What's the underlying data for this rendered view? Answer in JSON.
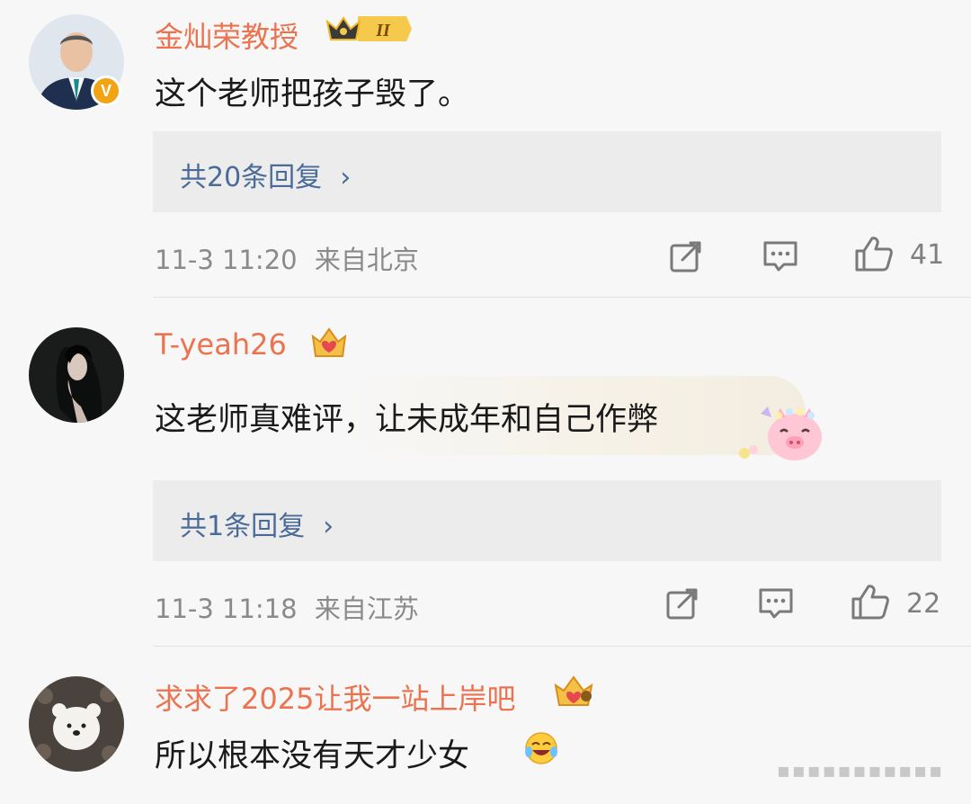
{
  "comments": [
    {
      "username": "金灿荣教授",
      "badge_level": "II",
      "verified_mark": "V",
      "text": "这个老师把孩子毁了。",
      "replies_label": "共20条回复",
      "time": "11-3 11:20",
      "location": "来自北京",
      "likes": "41"
    },
    {
      "username": "T-yeah26",
      "text": "这老师真难评，让未成年和自己作弊",
      "replies_label": "共1条回复",
      "time": "11-3 11:18",
      "location": "来自江苏",
      "likes": "22"
    },
    {
      "username": "求求了2025让我一站上岸吧",
      "text": "所以根本没有天才少女"
    }
  ],
  "icons": {
    "share": "share-icon",
    "comment": "comment-icon",
    "like": "thumbs-up-icon",
    "chevron": "chevron-right-icon",
    "emoji": "laugh-cry-emoji-icon",
    "sticker": "pig-sticker-icon"
  },
  "colors": {
    "username": "#eb7350",
    "link": "#4a6a98",
    "meta": "#8a8a8a",
    "verified": "#f2a414"
  }
}
